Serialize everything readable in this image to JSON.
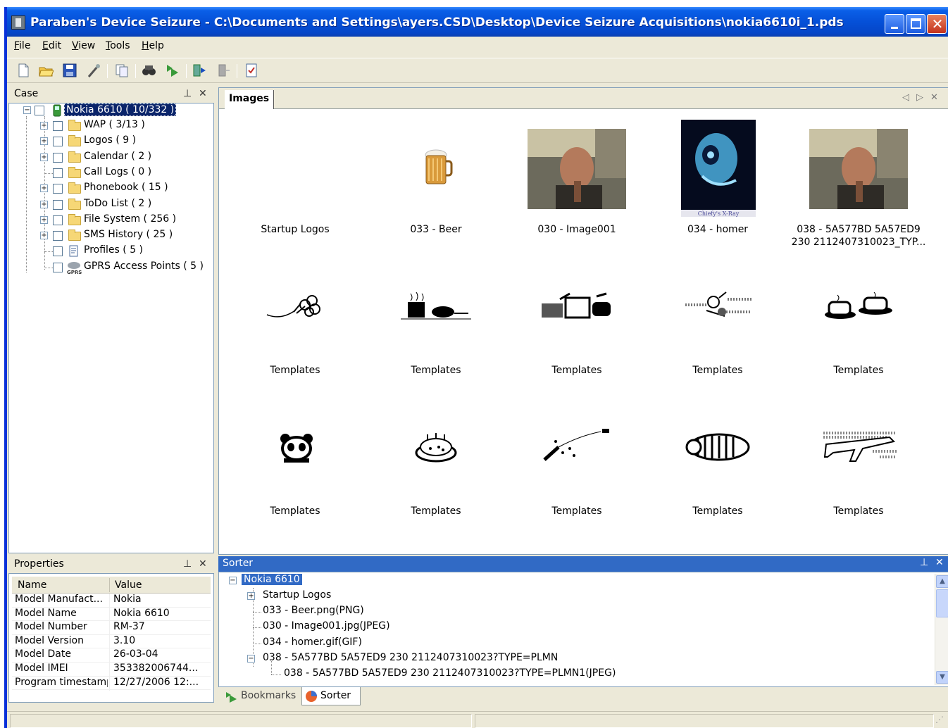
{
  "window": {
    "title": "Paraben's Device Seizure - C:\\Documents and Settings\\ayers.CSD\\Desktop\\Device Seizure Acquisitions\\nokia6610i_1.pds"
  },
  "menu": [
    {
      "label": "File",
      "u": "F",
      "rest": "ile"
    },
    {
      "label": "Edit",
      "u": "E",
      "rest": "dit"
    },
    {
      "label": "View",
      "u": "V",
      "rest": "iew"
    },
    {
      "label": "Tools",
      "u": "T",
      "rest": "ools"
    },
    {
      "label": "Help",
      "u": "H",
      "rest": "elp"
    }
  ],
  "toolbar": [
    "new-file-icon",
    "open-folder-icon",
    "save-icon",
    "wizard-icon",
    "copy-icon",
    "find-icon",
    "bookmark-icon",
    "acquire-icon",
    "disconnect-icon",
    "report-icon"
  ],
  "case_pane": {
    "title": "Case",
    "root": "Nokia 6610 ( 10/332 )",
    "items": [
      {
        "label": "WAP ( 3/13 )"
      },
      {
        "label": "Logos ( 9 )"
      },
      {
        "label": "Calendar ( 2 )"
      },
      {
        "label": "Call Logs ( 0 )"
      },
      {
        "label": "Phonebook ( 15 )"
      },
      {
        "label": "ToDo List ( 2 )"
      },
      {
        "label": "File System ( 256 )"
      },
      {
        "label": "SMS History ( 25 )"
      },
      {
        "label": "Profiles ( 5 )"
      },
      {
        "label": "GPRS Access Points ( 5 )"
      }
    ]
  },
  "images_pane": {
    "tab": "Images",
    "thumbs": [
      {
        "caption": "Startup Logos"
      },
      {
        "caption": "033 - Beer"
      },
      {
        "caption": "030 - Image001"
      },
      {
        "caption": "034 - homer",
        "image_text": "Chiefy's X-Ray"
      },
      {
        "caption": "038 - 5A577BD 5A57ED9 230 2112407310023_TYP..."
      },
      {
        "caption": "Templates"
      },
      {
        "caption": "Templates"
      },
      {
        "caption": "Templates"
      },
      {
        "caption": "Templates"
      },
      {
        "caption": "Templates"
      },
      {
        "caption": "Templates"
      },
      {
        "caption": "Templates"
      },
      {
        "caption": "Templates"
      },
      {
        "caption": "Templates"
      },
      {
        "caption": "Templates"
      }
    ]
  },
  "properties": {
    "title": "Properties",
    "col_name": "Name",
    "col_value": "Value",
    "rows": [
      {
        "name": "Model Manufact...",
        "value": "Nokia"
      },
      {
        "name": "Model Name",
        "value": "Nokia 6610"
      },
      {
        "name": "Model Number",
        "value": "RM-37"
      },
      {
        "name": "Model Version",
        "value": "3.10"
      },
      {
        "name": "Model Date",
        "value": "26-03-04"
      },
      {
        "name": "Model IMEI",
        "value": "353382006744..."
      },
      {
        "name": "Program timestamp",
        "value": "12/27/2006 12:..."
      }
    ]
  },
  "sorter": {
    "title": "Sorter",
    "root": "Nokia 6610",
    "items": [
      "Startup Logos",
      "033 - Beer.png(PNG)",
      "030 - Image001.jpg(JPEG)",
      "034 - homer.gif(GIF)",
      "038 - 5A577BD 5A57ED9 230 2112407310023?TYPE=PLMN",
      "038 - 5A577BD 5A57ED9 230 2112407310023?TYPE=PLMN1(JPEG)"
    ]
  },
  "bottom_tabs": {
    "bookmarks": "Bookmarks",
    "sorter": "Sorter"
  }
}
